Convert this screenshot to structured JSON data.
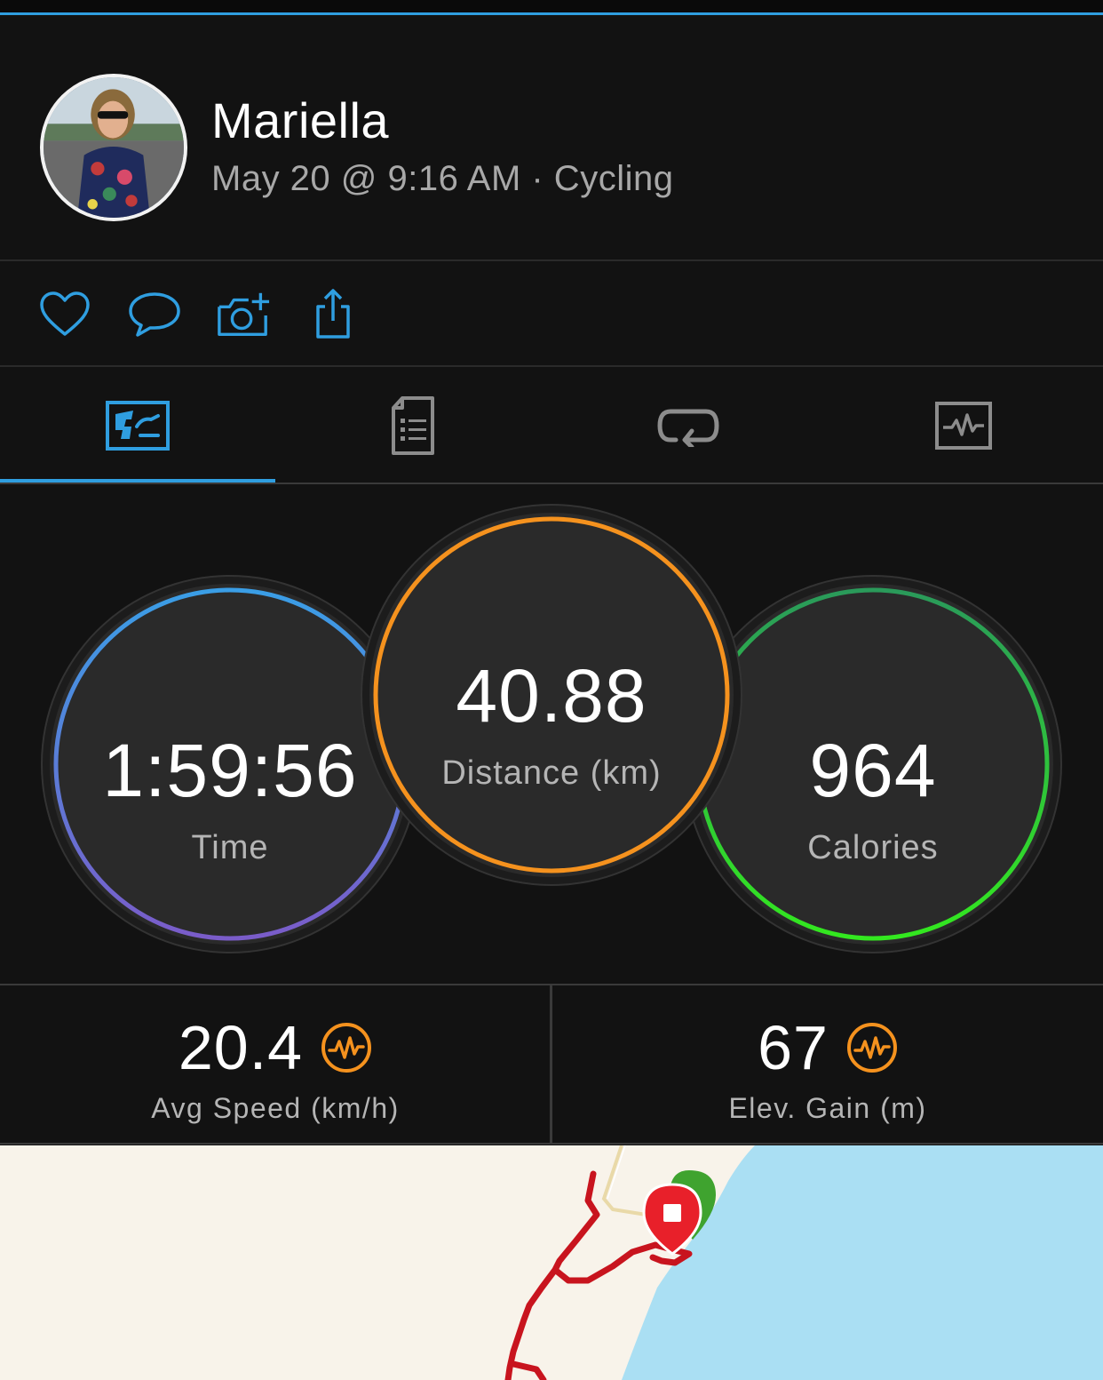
{
  "header": {
    "user_name": "Mariella",
    "activity_meta": "May 20 @ 9:16 AM · Cycling"
  },
  "actions": [
    {
      "name": "like",
      "icon": "heart-icon"
    },
    {
      "name": "comment",
      "icon": "comment-icon"
    },
    {
      "name": "add-photo",
      "icon": "camera-plus-icon"
    },
    {
      "name": "share",
      "icon": "share-icon"
    }
  ],
  "tabs": [
    {
      "name": "overview",
      "icon": "overview-map-icon",
      "active": true
    },
    {
      "name": "details",
      "icon": "document-list-icon",
      "active": false
    },
    {
      "name": "laps",
      "icon": "laps-loop-icon",
      "active": false
    },
    {
      "name": "charts",
      "icon": "chart-pulse-icon",
      "active": false
    }
  ],
  "stats": {
    "time": {
      "value": "1:59:56",
      "label": "Time"
    },
    "distance": {
      "value": "40.88",
      "label": "Distance (km)"
    },
    "calories": {
      "value": "964",
      "label": "Calories"
    }
  },
  "sub_stats": {
    "avg_speed": {
      "value": "20.4",
      "label": "Avg Speed (km/h)",
      "icon": "insight-pulse-icon"
    },
    "elev_gain": {
      "value": "67",
      "label": "Elev. Gain (m)",
      "icon": "insight-pulse-icon"
    }
  },
  "colors": {
    "accent": "#2f9ee0",
    "time_ring_top": "#3a9ee6",
    "time_ring_bottom": "#7a5cc9",
    "distance_ring": "#f5921e",
    "calories_ring_top": "#2a9a5a",
    "calories_ring_bottom": "#33e81f",
    "insight_orange": "#f5921e",
    "map_land": "#f8f3ea",
    "map_water": "#aadff3",
    "route": "#c8141e",
    "start_marker": "#3fa32f",
    "end_marker": "#e8202a"
  }
}
